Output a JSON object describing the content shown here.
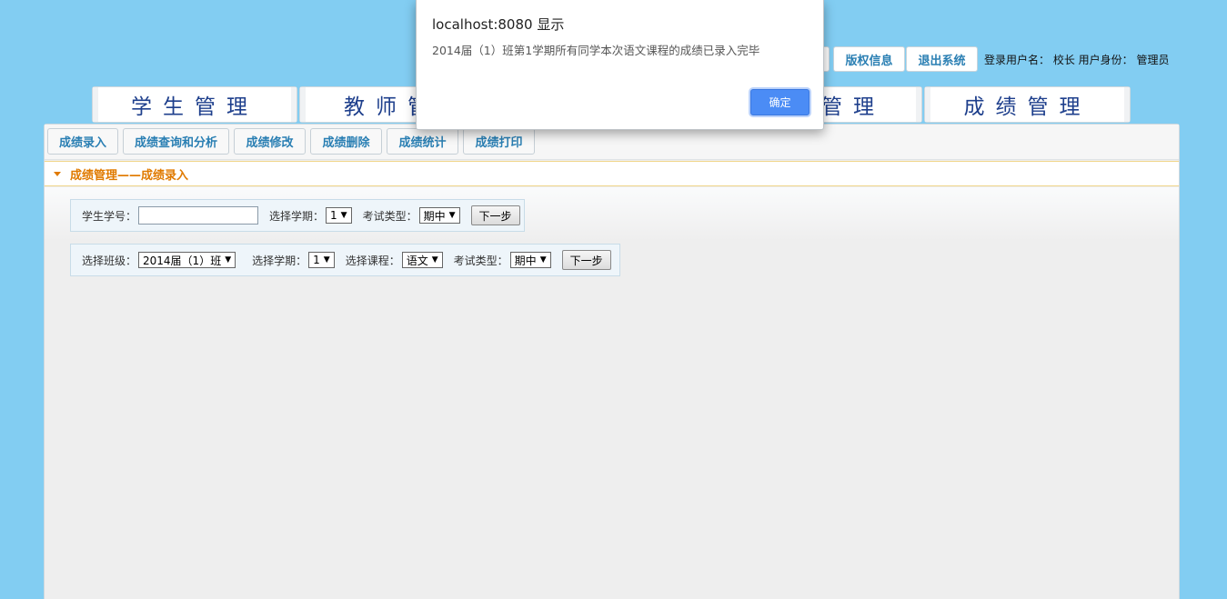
{
  "header": {
    "copyright_label": "版权信息",
    "logout_label": "退出系统",
    "user_info": "登录用户名： 校长 用户身份： 管理员"
  },
  "main_nav": {
    "items": [
      {
        "label": "学生管理"
      },
      {
        "label": "教师管"
      },
      {
        "label": "管理"
      },
      {
        "label": "成绩管理"
      }
    ]
  },
  "sub_nav": {
    "items": [
      {
        "label": "成绩录入"
      },
      {
        "label": "成绩查询和分析"
      },
      {
        "label": "成绩修改"
      },
      {
        "label": "成绩删除"
      },
      {
        "label": "成绩统计"
      },
      {
        "label": "成绩打印"
      }
    ]
  },
  "section": {
    "title": "成绩管理——成绩录入"
  },
  "form1": {
    "student_id_label": "学生学号：",
    "student_id_value": "",
    "term_label": "选择学期：",
    "term_value": "1",
    "exam_type_label": "考试类型：",
    "exam_type_value": "期中",
    "next_label": "下一步"
  },
  "form2": {
    "class_label": "选择班级：",
    "class_value": "2014届（1）班",
    "term_label": "选择学期：",
    "term_value": "1",
    "course_label": "选择课程：",
    "course_value": "语文",
    "exam_type_label": "考试类型：",
    "exam_type_value": "期中",
    "next_label": "下一步"
  },
  "dialog": {
    "title": "localhost:8080 显示",
    "message": "2014届（1）班第1学期所有同学本次语文课程的成绩已录入完毕",
    "ok_label": "确定"
  },
  "colors": {
    "background": "#82cdf2",
    "link_blue": "#2a7fb3",
    "section_orange": "#e07a00",
    "dialog_button": "#4b8cf5"
  }
}
